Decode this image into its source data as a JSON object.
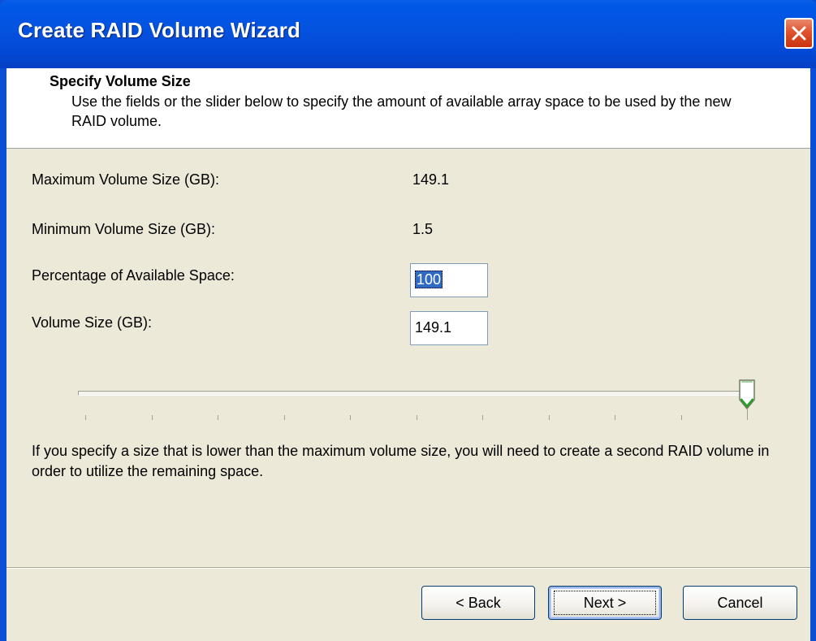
{
  "window": {
    "title": "Create RAID Volume Wizard"
  },
  "header": {
    "title": "Specify Volume Size",
    "description": "Use the fields or the slider below to specify the amount of available array space to be used by the new RAID volume."
  },
  "fields": {
    "max_label": "Maximum Volume Size (GB):",
    "max_value": "149.1",
    "min_label": "Minimum Volume Size (GB):",
    "min_value": "1.5",
    "percent_label": "Percentage of Available Space:",
    "percent_value": "100",
    "size_label": "Volume Size (GB):",
    "size_value": "149.1"
  },
  "slider": {
    "value_percent": 100,
    "tick_count": 11
  },
  "footnote": "If you specify a size that is lower than the maximum volume size, you will need to create a second RAID volume in order to utilize the remaining space.",
  "buttons": {
    "back": "< Back",
    "next": "Next >",
    "cancel": "Cancel"
  },
  "colors": {
    "titlebar": "#0453e0",
    "dialog_face": "#ece9d8",
    "selection": "#316ac5",
    "close_button": "#e0512f"
  }
}
